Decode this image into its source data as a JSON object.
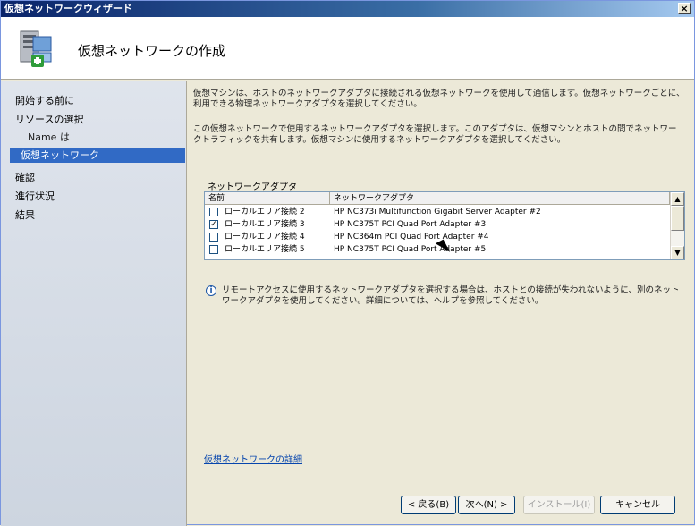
{
  "window": {
    "title": "仮想ネットワークウィザード",
    "close_label": "×"
  },
  "header": {
    "title": "仮想ネットワークの作成",
    "icon": "network-wizard-icon"
  },
  "sidebar": {
    "items": [
      {
        "label": "開始する前に"
      },
      {
        "label": "リソースの選択"
      },
      {
        "label": "Name は"
      },
      {
        "label": "仮想ネットワーク"
      },
      {
        "label": "確認"
      },
      {
        "label": "進行状況"
      },
      {
        "label": "結果"
      }
    ],
    "selected_index": 3
  },
  "main": {
    "para1": "仮想マシンは、ホストのネットワークアダプタに接続される仮想ネットワークを使用して通信します。仮想ネットワークごとに、利用できる物理ネットワークアダプタを選択してください。",
    "para2": "この仮想ネットワークで使用するネットワークアダプタを選択します。このアダプタは、仮想マシンとホストの間でネットワークトラフィックを共有します。仮想マシンに使用するネットワークアダプタを選択してください。",
    "group_label": "ネットワークアダプタ",
    "columns": [
      "名前",
      "ネットワークアダプタ"
    ],
    "rows": [
      {
        "checked": false,
        "name": "ローカルエリア接続 2",
        "adapter": "HP NC373i Multifunction Gigabit Server Adapter #2"
      },
      {
        "checked": true,
        "name": "ローカルエリア接続 3",
        "adapter": "HP NC375T PCI Quad Port Adapter #3"
      },
      {
        "checked": false,
        "name": "ローカルエリア接続 4",
        "adapter": "HP NC364m PCI Quad Port Adapter #4"
      },
      {
        "checked": false,
        "name": "ローカルエリア接続 5",
        "adapter": "HP NC375T PCI Quad Port Adapter #5"
      }
    ],
    "info_text": "リモートアクセスに使用するネットワークアダプタを選択する場合は、ホストとの接続が失われないように、別のネットワークアダプタを使用してください。詳細については、ヘルプを参照してください。",
    "link": "仮想ネットワークの詳細"
  },
  "buttons": {
    "back": "< 戻る(B)",
    "next": "次へ(N) >",
    "finish": "インストール(I)",
    "cancel": "キャンセル"
  }
}
